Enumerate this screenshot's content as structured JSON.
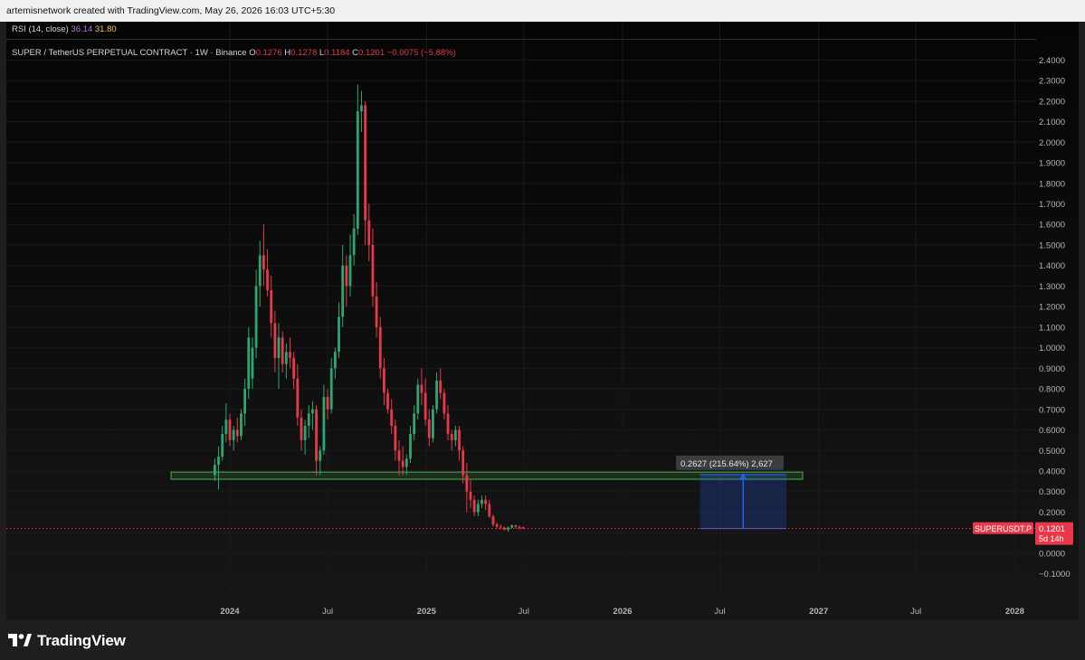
{
  "header": {
    "text": "artemisnetwork created with TradingView.com, May 26, 2026 16:03 UTC+5:30"
  },
  "indicator": {
    "label": "RSI (14, close)",
    "value1": "36.14",
    "value2": "31.80",
    "color1": "#a97bd8",
    "color2": "#e8c75a"
  },
  "legend": {
    "symbol": "SUPER / TetherUS PERPETUAL CONTRACT · 1W · Binance",
    "o_label": "O",
    "o_value": "0.1276",
    "h_label": "H",
    "h_value": "0.1278",
    "l_label": "L",
    "l_value": "0.1184",
    "c_label": "C",
    "c_value": "0.1201",
    "change": "−0.0075 (−5.88%)"
  },
  "price_tag": {
    "symbol": "SUPERUSDT.P",
    "price": "0.1201",
    "countdown": "5d 14h"
  },
  "measure_label": "0.2627 (215.64%) 2,627",
  "brand": "TradingView",
  "colors": {
    "up": "#2ea672",
    "down": "#e8394a",
    "support": "#4caf50",
    "measure": "#2962ff",
    "background": "#070707",
    "axis_text": "#b2b5be"
  },
  "chart_data": {
    "type": "candlestick",
    "interval": "1W",
    "x_ticks": [
      "2024",
      "Jul",
      "2025",
      "Jul",
      "2026",
      "Jul",
      "2027",
      "Jul",
      "2028"
    ],
    "y_ticks": [
      "2.4000",
      "2.3000",
      "2.2000",
      "2.1000",
      "2.0000",
      "1.9000",
      "1.8000",
      "1.7000",
      "1.6000",
      "1.5000",
      "1.4000",
      "1.3000",
      "1.2000",
      "1.1000",
      "1.0000",
      "0.9000",
      "0.8000",
      "0.7000",
      "0.6000",
      "0.5000",
      "0.4000",
      "0.3000",
      "0.2000",
      "0.1000",
      "0.0000",
      "−0.1000"
    ],
    "ylim": [
      -0.15,
      2.45
    ],
    "start_date": "2023-12-04",
    "last_close": 0.1201,
    "support_zone": [
      0.36,
      0.395
    ],
    "measure": {
      "from": 0.1201,
      "to": 0.3828,
      "start_date": "2026-05-25",
      "end_date": "2026-11-02"
    },
    "candles": [
      [
        0.38,
        0.46,
        0.35,
        0.43
      ],
      [
        0.43,
        0.52,
        0.31,
        0.47
      ],
      [
        0.47,
        0.62,
        0.45,
        0.58
      ],
      [
        0.58,
        0.73,
        0.54,
        0.65
      ],
      [
        0.65,
        0.68,
        0.52,
        0.55
      ],
      [
        0.55,
        0.62,
        0.5,
        0.6
      ],
      [
        0.6,
        0.66,
        0.54,
        0.57
      ],
      [
        0.57,
        0.7,
        0.55,
        0.68
      ],
      [
        0.68,
        0.85,
        0.62,
        0.8
      ],
      [
        0.8,
        1.1,
        0.75,
        1.05
      ],
      [
        0.85,
        1.05,
        0.8,
        1.0
      ],
      [
        1.0,
        1.38,
        0.95,
        1.3
      ],
      [
        1.3,
        1.52,
        1.2,
        1.45
      ],
      [
        1.45,
        1.6,
        1.3,
        1.38
      ],
      [
        1.38,
        1.48,
        1.25,
        1.28
      ],
      [
        1.28,
        1.35,
        1.05,
        1.12
      ],
      [
        1.12,
        1.18,
        0.88,
        0.95
      ],
      [
        0.95,
        1.12,
        0.8,
        1.05
      ],
      [
        1.05,
        1.08,
        0.88,
        0.92
      ],
      [
        0.92,
        1.02,
        0.85,
        0.98
      ],
      [
        0.98,
        1.05,
        0.9,
        0.95
      ],
      [
        0.95,
        0.98,
        0.8,
        0.85
      ],
      [
        0.85,
        0.92,
        0.62,
        0.66
      ],
      [
        0.66,
        0.7,
        0.5,
        0.55
      ],
      [
        0.55,
        0.65,
        0.48,
        0.62
      ],
      [
        0.62,
        0.72,
        0.56,
        0.68
      ],
      [
        0.68,
        0.74,
        0.6,
        0.7
      ],
      [
        0.7,
        0.72,
        0.38,
        0.45
      ],
      [
        0.45,
        0.52,
        0.38,
        0.5
      ],
      [
        0.5,
        0.82,
        0.48,
        0.76
      ],
      [
        0.76,
        0.8,
        0.65,
        0.7
      ],
      [
        0.7,
        0.95,
        0.68,
        0.9
      ],
      [
        0.9,
        1.0,
        0.85,
        0.98
      ],
      [
        0.98,
        1.22,
        0.95,
        1.15
      ],
      [
        1.15,
        1.5,
        1.1,
        1.4
      ],
      [
        1.4,
        1.45,
        1.2,
        1.3
      ],
      [
        1.3,
        1.55,
        1.25,
        1.45
      ],
      [
        1.45,
        1.65,
        1.4,
        1.58
      ],
      [
        1.58,
        2.28,
        1.55,
        2.15
      ],
      [
        2.15,
        2.25,
        2.05,
        2.18
      ],
      [
        2.18,
        2.2,
        1.5,
        1.62
      ],
      [
        1.62,
        1.7,
        1.42,
        1.5
      ],
      [
        1.5,
        1.58,
        1.2,
        1.25
      ],
      [
        1.25,
        1.32,
        1.05,
        1.1
      ],
      [
        1.1,
        1.15,
        0.85,
        0.9
      ],
      [
        0.9,
        0.95,
        0.72,
        0.78
      ],
      [
        0.78,
        0.8,
        0.68,
        0.7
      ],
      [
        0.7,
        0.75,
        0.58,
        0.62
      ],
      [
        0.62,
        0.65,
        0.45,
        0.5
      ],
      [
        0.5,
        0.55,
        0.38,
        0.45
      ],
      [
        0.45,
        0.52,
        0.38,
        0.42
      ],
      [
        0.42,
        0.48,
        0.38,
        0.46
      ],
      [
        0.46,
        0.62,
        0.44,
        0.58
      ],
      [
        0.58,
        0.72,
        0.55,
        0.68
      ],
      [
        0.68,
        0.85,
        0.65,
        0.82
      ],
      [
        0.82,
        0.9,
        0.72,
        0.78
      ],
      [
        0.78,
        0.85,
        0.62,
        0.65
      ],
      [
        0.65,
        0.7,
        0.52,
        0.56
      ],
      [
        0.56,
        0.72,
        0.54,
        0.7
      ],
      [
        0.7,
        0.88,
        0.68,
        0.84
      ],
      [
        0.84,
        0.9,
        0.75,
        0.78
      ],
      [
        0.78,
        0.8,
        0.65,
        0.68
      ],
      [
        0.68,
        0.72,
        0.55,
        0.58
      ],
      [
        0.58,
        0.6,
        0.5,
        0.55
      ],
      [
        0.55,
        0.62,
        0.52,
        0.6
      ],
      [
        0.6,
        0.62,
        0.45,
        0.5
      ],
      [
        0.5,
        0.52,
        0.34,
        0.38
      ],
      [
        0.38,
        0.44,
        0.2,
        0.3
      ],
      [
        0.3,
        0.36,
        0.22,
        0.26
      ],
      [
        0.26,
        0.28,
        0.18,
        0.2
      ],
      [
        0.2,
        0.26,
        0.18,
        0.24
      ],
      [
        0.24,
        0.28,
        0.22,
        0.26
      ],
      [
        0.26,
        0.28,
        0.21,
        0.24
      ],
      [
        0.24,
        0.26,
        0.17,
        0.18
      ],
      [
        0.18,
        0.19,
        0.13,
        0.14
      ],
      [
        0.14,
        0.15,
        0.12,
        0.13
      ],
      [
        0.13,
        0.14,
        0.115,
        0.125
      ],
      [
        0.125,
        0.13,
        0.11,
        0.115
      ],
      [
        0.115,
        0.13,
        0.105,
        0.125
      ],
      [
        0.125,
        0.14,
        0.12,
        0.135
      ],
      [
        0.135,
        0.14,
        0.12,
        0.128
      ],
      [
        0.128,
        0.135,
        0.115,
        0.1276
      ],
      [
        0.1276,
        0.1278,
        0.1184,
        0.1201
      ]
    ]
  }
}
